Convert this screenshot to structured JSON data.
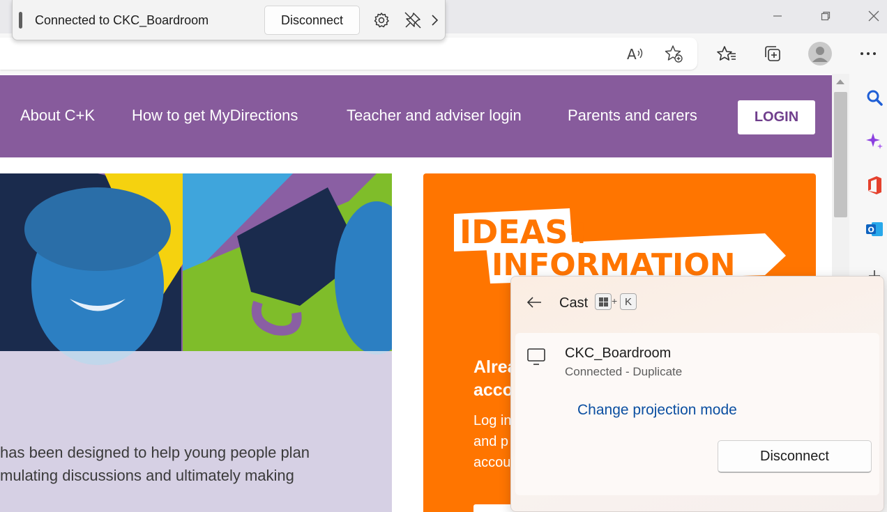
{
  "cast_toolbar": {
    "status": "Connected to CKC_Boardroom",
    "disconnect_label": "Disconnect",
    "icons": [
      "gear-icon",
      "unpin-icon",
      "chevron-right-icon"
    ]
  },
  "window_controls": [
    "minimize-icon",
    "restore-icon",
    "close-icon"
  ],
  "browser_toolbar": {
    "icons": [
      "read-aloud-icon",
      "add-favorite-icon",
      "favorites-icon",
      "collections-icon",
      "profile-avatar",
      "more-icon"
    ]
  },
  "site": {
    "nav": {
      "links": [
        "About C+K",
        "How to get MyDirections",
        "Teacher and adviser login",
        "Parents and carers"
      ],
      "login_label": "LOGIN"
    },
    "hero_text": {
      "line1": "has been designed to help young people plan",
      "line2": "mulating discussions and ultimately making"
    },
    "card": {
      "logo_line1": "IDEAS+",
      "logo_line2": "INFORMATION",
      "heading_line1": "Alrea",
      "heading_line2": "acco",
      "body_line1": "Log in",
      "body_line2": "and p",
      "body_line3": "accou"
    }
  },
  "sidebar": {
    "icons": [
      "search-icon",
      "copilot-icon",
      "office-icon",
      "outlook-icon",
      "add-icon"
    ]
  },
  "cast_flyout": {
    "title": "Cast",
    "shortcut_plus": "+",
    "shortcut_key": "K",
    "device_name": "CKC_Boardroom",
    "device_status": "Connected - Duplicate",
    "change_mode_label": "Change projection mode",
    "disconnect_label": "Disconnect"
  },
  "colors": {
    "nav_purple": "#875b9c",
    "card_orange": "#ff7500",
    "link_blue": "#0b4fa1"
  }
}
